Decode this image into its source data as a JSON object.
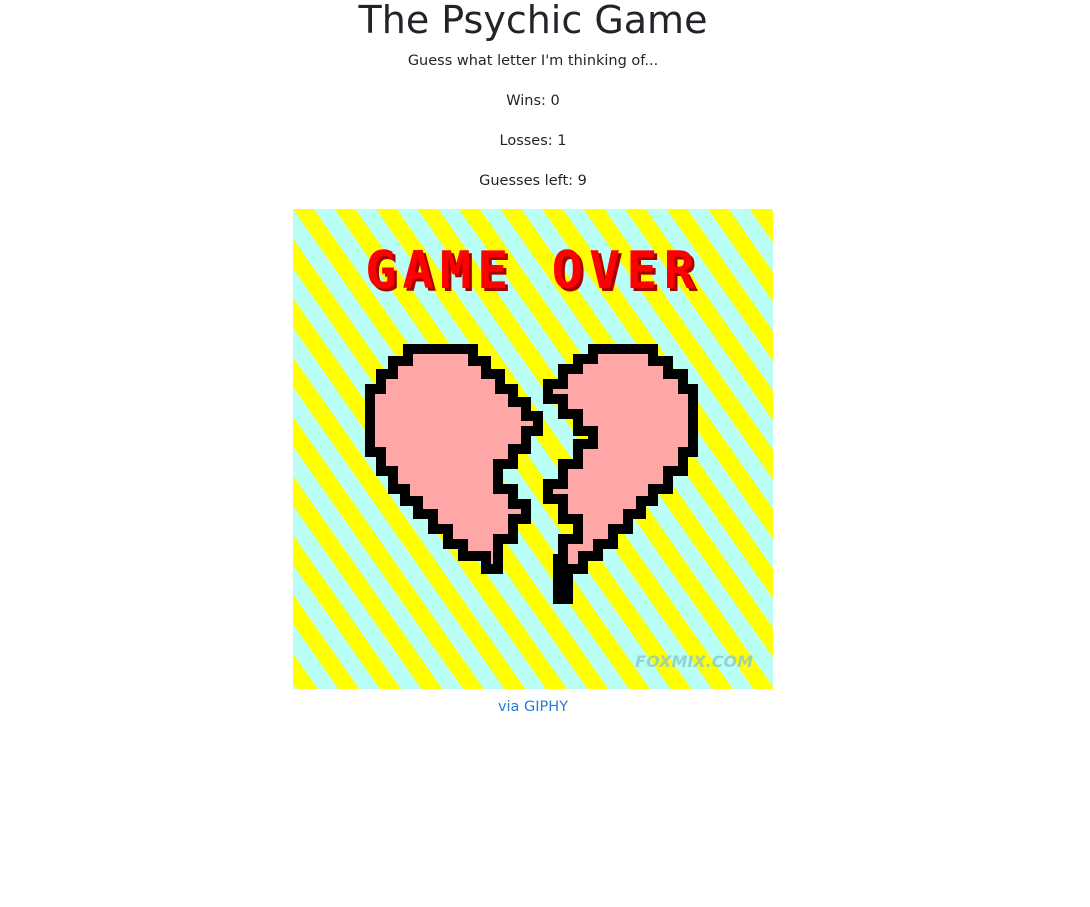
{
  "game": {
    "title": "The Psychic Game",
    "subtitle": "Guess what letter I'm thinking of...",
    "wins": "Wins: 0",
    "losses": "Losses: 1",
    "guesses_left": "Guesses left: 9"
  },
  "gif": {
    "caption": "GAME OVER",
    "watermark": "FOXMIX.COM",
    "colors": {
      "stripe_yellow": "#ffff00",
      "stripe_cyan": "#b9fff5",
      "heart_fill": "#ffa6a6",
      "heart_outline": "#000000",
      "text_red": "#ff0000"
    }
  },
  "link": {
    "label": "via GIPHY"
  },
  "colors": {
    "text": "#212529",
    "link": "#2b7ad6",
    "background": "#ffffff"
  }
}
